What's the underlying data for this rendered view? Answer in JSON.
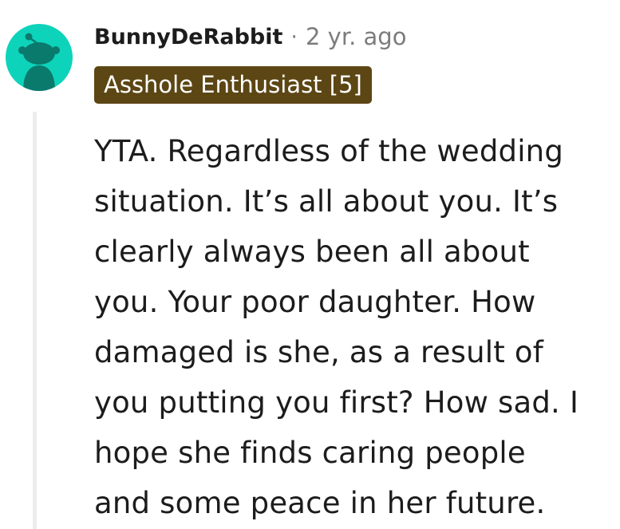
{
  "comment": {
    "author": "BunnyDeRabbit",
    "separator": "·",
    "timestamp": "2 yr. ago",
    "flair": "Asshole Enthusiast [5]",
    "body_lines": [
      "YTA. Regardless of the wedding",
      "situation. It’s all about you. It’s",
      "clearly always been all about",
      "you. Your poor daughter. How",
      "damaged is she, as a result of",
      "you putting you first? How sad. I",
      "hope she finds caring people",
      "and some peace in her future."
    ],
    "avatar_icon": "snoo-avatar-icon"
  },
  "colors": {
    "avatar_bg": "#0dd3bb",
    "flair_bg": "#5c4614",
    "flair_text": "#ffffff",
    "text": "#1c1c1c",
    "muted": "#7c7c7c",
    "thread_line": "#ededed"
  }
}
